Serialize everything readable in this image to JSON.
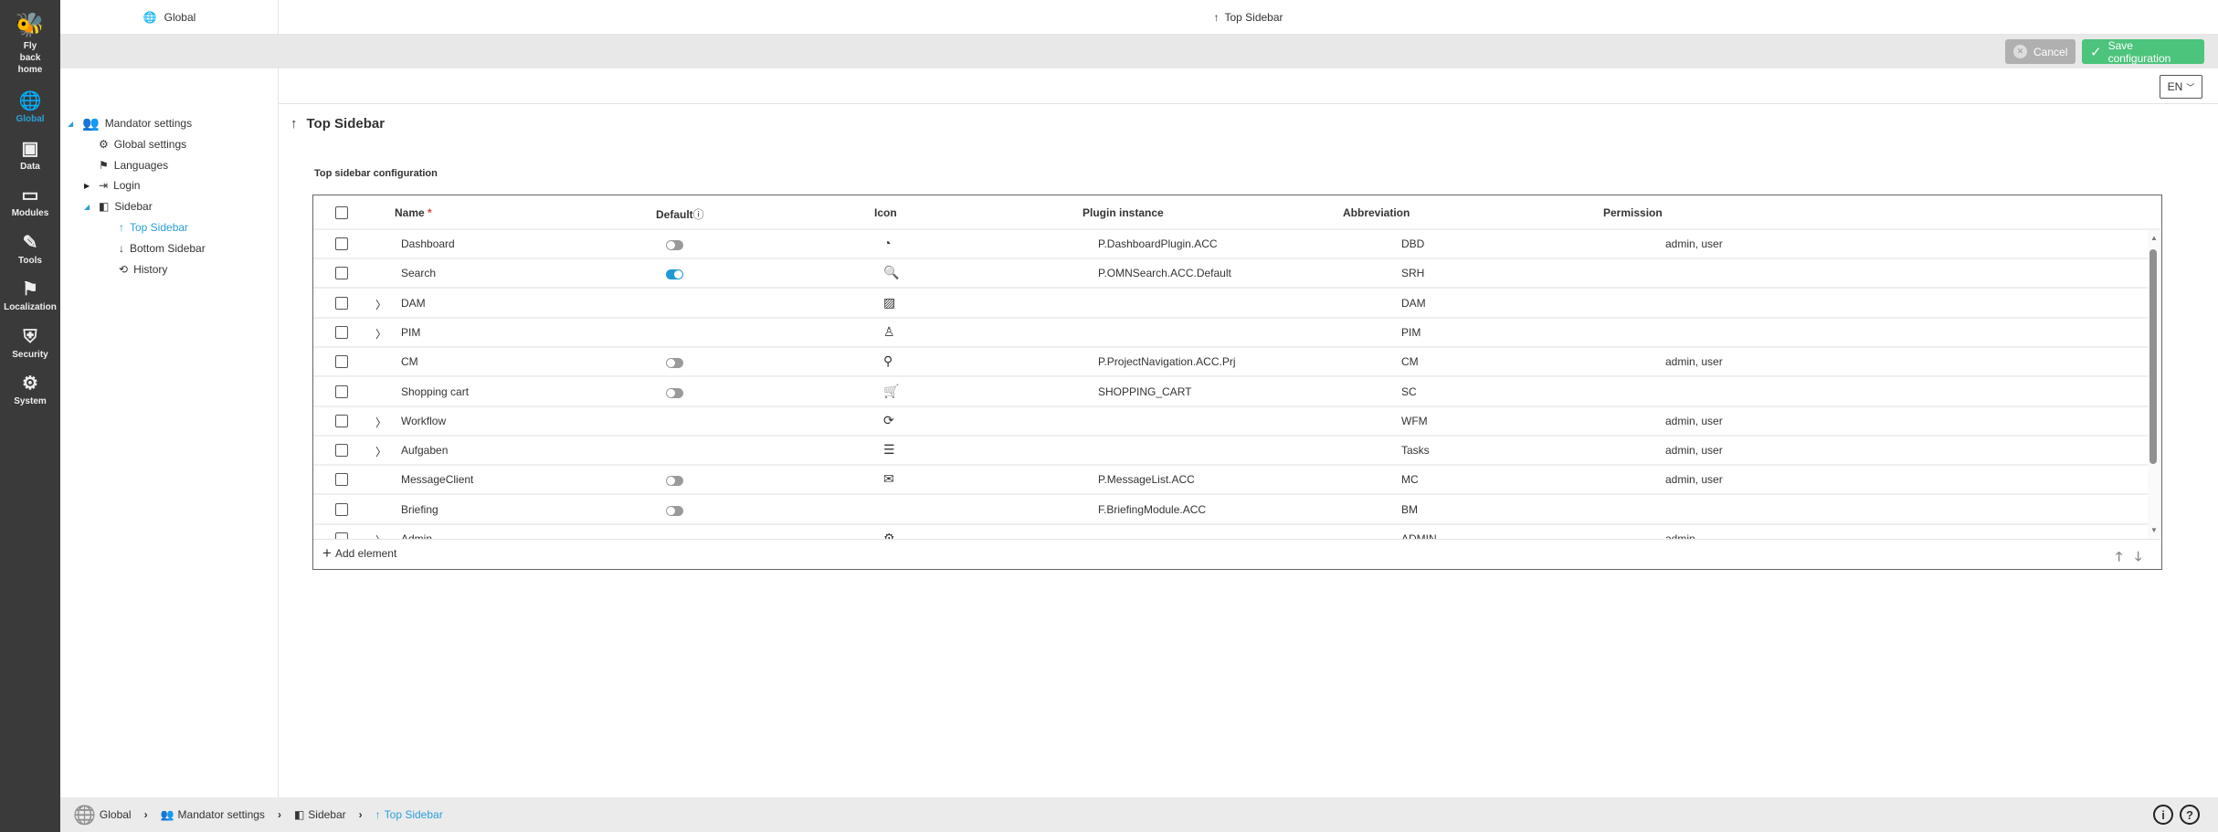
{
  "nav": {
    "home_label": "Fly back home",
    "items": [
      {
        "label": "Global",
        "icon": "globe-icon",
        "glyph": "🌐",
        "active": true
      },
      {
        "label": "Data",
        "icon": "calendar-edit-icon",
        "glyph": "▣"
      },
      {
        "label": "Modules",
        "icon": "window-icon",
        "glyph": "▭"
      },
      {
        "label": "Tools",
        "icon": "pencil-icon",
        "glyph": "✎"
      },
      {
        "label": "Localization",
        "icon": "flag-icon",
        "glyph": "⚑"
      },
      {
        "label": "Security",
        "icon": "shield-check-icon",
        "glyph": "⛨"
      },
      {
        "label": "System",
        "icon": "gear-wrench-icon",
        "glyph": "⚙"
      }
    ]
  },
  "tree": {
    "header": "Global",
    "items": [
      {
        "label": "Mandator settings",
        "icon": "user-gear-icon",
        "glyph": "👥",
        "level": 0,
        "toggle": "◢"
      },
      {
        "label": "Global settings",
        "icon": "gear-icon",
        "glyph": "⚙",
        "level": 1
      },
      {
        "label": "Languages",
        "icon": "flag-icon",
        "glyph": "⚑",
        "level": 1
      },
      {
        "label": "Login",
        "icon": "sign-in-icon",
        "glyph": "⇥",
        "level": 1,
        "toggle": "▶"
      },
      {
        "label": "Sidebar",
        "icon": "sidebar-icon",
        "glyph": "◧",
        "level": 1,
        "toggle": "◢"
      },
      {
        "label": "Top Sidebar",
        "icon": "arrow-up-icon",
        "glyph": "↑",
        "level": 2,
        "active": true
      },
      {
        "label": "Bottom Sidebar",
        "icon": "arrow-down-icon",
        "glyph": "↓",
        "level": 2
      },
      {
        "label": "History",
        "icon": "history-icon",
        "glyph": "⟲",
        "level": 2
      }
    ]
  },
  "header": {
    "title": "Top Sidebar"
  },
  "toolbar": {
    "cancel_label": "Cancel",
    "save_label": "Save configuration",
    "language": "EN"
  },
  "main": {
    "title": "Top Sidebar",
    "section_title": "Top sidebar configuration",
    "columns": {
      "name": "Name",
      "required": "*",
      "default": "Default",
      "icon": "Icon",
      "plugin": "Plugin instance",
      "abbreviation": "Abbreviation",
      "permission": "Permission"
    },
    "rows": [
      {
        "name": "Dashboard",
        "expandable": false,
        "default": false,
        "icon": "dashboard-gauge-icon",
        "glyph": "◔",
        "plugin": "P.DashboardPlugin.ACC",
        "abbr": "DBD",
        "perm": "admin, user"
      },
      {
        "name": "Search",
        "expandable": false,
        "default": true,
        "icon": "search-icon",
        "glyph": "🔍",
        "plugin": "P.OMNSearch.ACC.Default",
        "abbr": "SRH",
        "perm": ""
      },
      {
        "name": "DAM",
        "expandable": true,
        "icon": "images-icon",
        "glyph": "▨",
        "plugin": "",
        "abbr": "DAM",
        "perm": ""
      },
      {
        "name": "PIM",
        "expandable": true,
        "icon": "product-icon",
        "glyph": "♙",
        "plugin": "",
        "abbr": "PIM",
        "perm": ""
      },
      {
        "name": "CM",
        "expandable": false,
        "default": false,
        "icon": "network-icon",
        "glyph": "⚲",
        "plugin": "P.ProjectNavigation.ACC.Prj",
        "abbr": "CM",
        "perm": "admin, user"
      },
      {
        "name": "Shopping cart",
        "expandable": false,
        "default": false,
        "icon": "cart-icon",
        "glyph": "🛒",
        "plugin": "SHOPPING_CART",
        "abbr": "SC",
        "perm": ""
      },
      {
        "name": "Workflow",
        "expandable": true,
        "icon": "workflow-icon",
        "glyph": "⟳",
        "plugin": "",
        "abbr": "WFM",
        "perm": "admin, user"
      },
      {
        "name": "Aufgaben",
        "expandable": true,
        "icon": "task-list-icon",
        "glyph": "☰",
        "plugin": "",
        "abbr": "Tasks",
        "perm": "admin, user"
      },
      {
        "name": "MessageClient",
        "expandable": false,
        "default": false,
        "icon": "envelope-icon",
        "glyph": "✉",
        "plugin": "P.MessageList.ACC",
        "abbr": "MC",
        "perm": "admin, user"
      },
      {
        "name": "Briefing",
        "expandable": false,
        "default": false,
        "icon": "",
        "glyph": "",
        "plugin": "F.BriefingModule.ACC",
        "abbr": "BM",
        "perm": ""
      },
      {
        "name": "Admin",
        "expandable": true,
        "icon": "gear-icon",
        "glyph": "⚙",
        "plugin": "",
        "abbr": "ADMIN",
        "perm": "admin"
      }
    ],
    "add_label": "Add element"
  },
  "breadcrumb": [
    {
      "label": "Global",
      "glyph": "🌐",
      "icon": "globe-icon"
    },
    {
      "label": "Mandator settings",
      "glyph": "👥",
      "icon": "user-gear-icon"
    },
    {
      "label": "Sidebar",
      "glyph": "◧",
      "icon": "sidebar-icon"
    },
    {
      "label": "Top Sidebar",
      "glyph": "↑",
      "icon": "arrow-up-icon",
      "active": true
    }
  ],
  "colors": {
    "accent": "#2a9fd8",
    "save": "#4cc47c",
    "cancel": "#b0b0b0",
    "nav_bg": "#3a3a3a"
  }
}
